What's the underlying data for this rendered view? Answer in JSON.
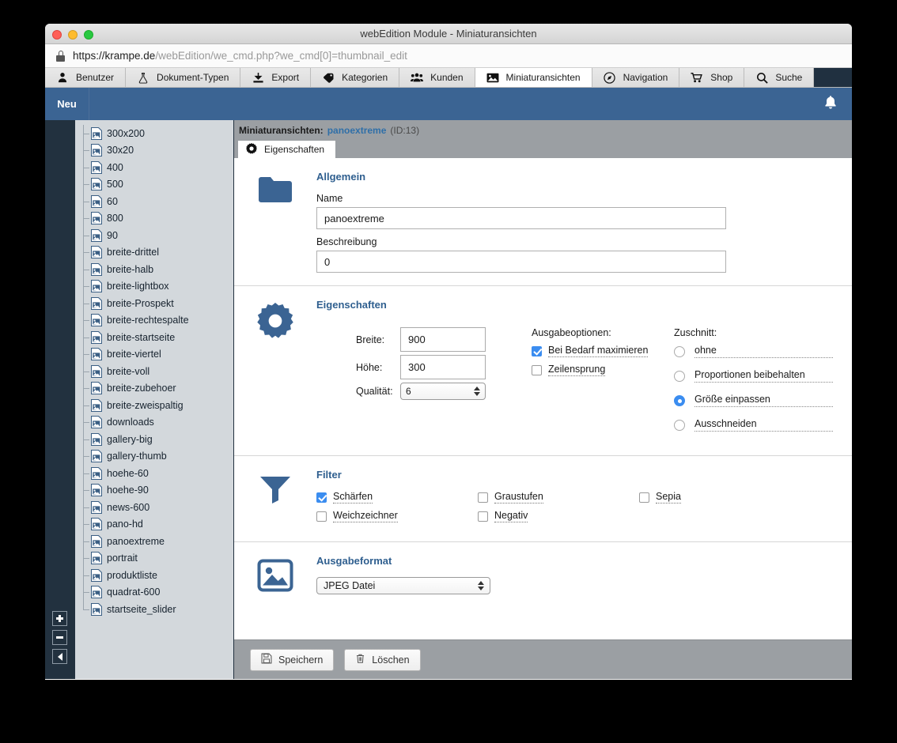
{
  "window": {
    "title": "webEdition Module - Miniaturansichten",
    "url_host": "https://krampe.de",
    "url_path": "/webEdition/we_cmd.php?we_cmd[0]=thumbnail_edit",
    "traffic_lights": [
      "close",
      "minimize",
      "zoom"
    ]
  },
  "module_tabs": [
    {
      "label": "Benutzer",
      "icon": "user-icon",
      "active": false
    },
    {
      "label": "Dokument-Typen",
      "icon": "flask-icon",
      "active": false
    },
    {
      "label": "Export",
      "icon": "download-icon",
      "active": false
    },
    {
      "label": "Kategorien",
      "icon": "tag-icon",
      "active": false
    },
    {
      "label": "Kunden",
      "icon": "users-icon",
      "active": false
    },
    {
      "label": "Miniaturansichten",
      "icon": "image-icon",
      "active": true
    },
    {
      "label": "Navigation",
      "icon": "compass-icon",
      "active": false
    },
    {
      "label": "Shop",
      "icon": "cart-icon",
      "active": false
    },
    {
      "label": "Suche",
      "icon": "search-icon",
      "active": false
    }
  ],
  "actionbar": {
    "new_label": "Neu",
    "bell_icon": "bell-icon",
    "bg_color": "#3b6493"
  },
  "tree": {
    "items": [
      "300x200",
      "30x20",
      "400",
      "500",
      "60",
      "800",
      "90",
      "breite-drittel",
      "breite-halb",
      "breite-lightbox",
      "breite-Prospekt",
      "breite-rechtespalte",
      "breite-startseite",
      "breite-viertel",
      "breite-voll",
      "breite-zubehoer",
      "breite-zweispaltig",
      "downloads",
      "gallery-big",
      "gallery-thumb",
      "hoehe-60",
      "hoehe-90",
      "news-600",
      "pano-hd",
      "panoextreme",
      "portrait",
      "produktliste",
      "quadrat-600",
      "startseite_slider"
    ],
    "rail_buttons": [
      {
        "name": "add",
        "glyph": "+"
      },
      {
        "name": "remove",
        "glyph": "−"
      },
      {
        "name": "collapse",
        "glyph": "◀"
      }
    ]
  },
  "breadcrumb": {
    "prefix": "Miniaturansichten:",
    "name": "panoextreme",
    "id": "(ID:13)"
  },
  "panel_tab": {
    "label": "Eigenschaften",
    "icon": "gear-icon"
  },
  "allgemein": {
    "title": "Allgemein",
    "icon": "folder-icon",
    "name_label": "Name",
    "name_value": "panoextreme",
    "beschreibung_label": "Beschreibung",
    "beschreibung_value": "0"
  },
  "eigenschaften": {
    "title": "Eigenschaften",
    "icon": "gear-icon",
    "breite_label": "Breite:",
    "breite_value": "900",
    "hoehe_label": "Höhe:",
    "hoehe_value": "300",
    "qualitaet_label": "Qualität:",
    "qualitaet_value": "6",
    "ausgabeoptionen_label": "Ausgabeoptionen:",
    "options": [
      {
        "label": "Bei Bedarf maximieren",
        "checked": true
      },
      {
        "label": "Zeilensprung",
        "checked": false
      }
    ],
    "zuschnitt_label": "Zuschnitt:",
    "crop_options": [
      {
        "label": "ohne",
        "selected": false
      },
      {
        "label": "Proportionen beibehalten",
        "selected": false
      },
      {
        "label": "Größe einpassen",
        "selected": true
      },
      {
        "label": "Ausschneiden",
        "selected": false
      }
    ]
  },
  "filter": {
    "title": "Filter",
    "icon": "funnel-icon",
    "col1": [
      {
        "label": "Schärfen",
        "checked": true
      },
      {
        "label": "Weichzeichner",
        "checked": false
      }
    ],
    "col2": [
      {
        "label": "Graustufen",
        "checked": false
      },
      {
        "label": "Negativ",
        "checked": false
      }
    ],
    "col3": [
      {
        "label": "Sepia",
        "checked": false
      }
    ]
  },
  "ausgabeformat": {
    "title": "Ausgabeformat",
    "icon": "picture-icon",
    "selected": "JPEG Datei"
  },
  "footer": {
    "save_label": "Speichern",
    "save_icon": "floppy-icon",
    "delete_label": "Löschen",
    "delete_icon": "trash-icon"
  },
  "colors": {
    "accent_blue": "#3b6493",
    "link_blue": "#2f6fa8",
    "dark_rail": "#22313f",
    "tree_bg": "#d3d8dc",
    "panel_gray": "#9b9fa3",
    "control_blue": "#3b8df0"
  }
}
